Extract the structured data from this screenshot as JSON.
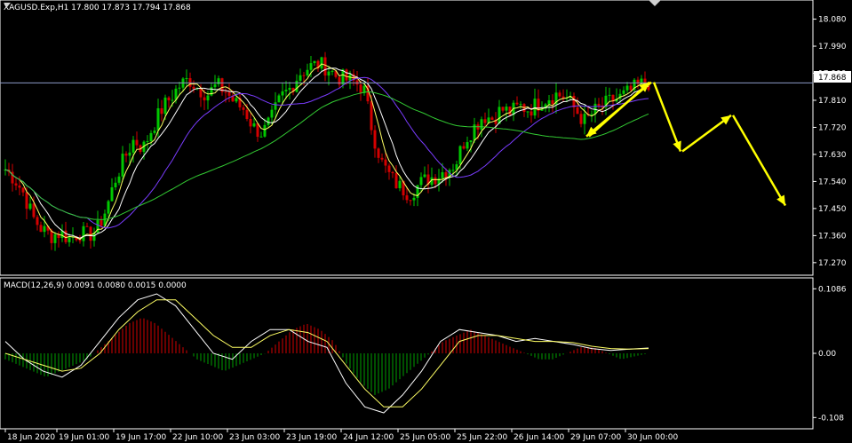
{
  "header": {
    "symbol_line": "XAGUSD.Exp,H1  17.800 17.873 17.794 17.868",
    "macd_line": "MACD(12,26,9) 0.0091 0.0080 0.0015 0.0000"
  },
  "colors": {
    "background": "#000000",
    "bull_candle": "#00c800",
    "bear_candle": "#d40000",
    "ma_fast": "#ffff64",
    "ma_mid": "#ffffff",
    "ma_slow_violet": "#7a3cff",
    "ma_slow_green": "#32c832",
    "macd_line": "#ffffff",
    "signal_line": "#ffff64",
    "hist_pos": "#d40000",
    "hist_neg": "#00a000",
    "arrows": "#ffff00",
    "axis_text": "#ffffff",
    "price_line": "#8c9ac8"
  },
  "chart_data": [
    {
      "type": "candlestick",
      "ylim": [
        17.24,
        18.12
      ],
      "y_ticks": [
        "18.080",
        "17.990",
        "17.900",
        "17.810",
        "17.720",
        "17.630",
        "17.540",
        "17.450",
        "17.360",
        "17.270"
      ],
      "x_ticks": [
        "18 Jun 2020",
        "19 Jun 01:00",
        "19 Jun 17:00",
        "22 Jun 10:00",
        "23 Jun 03:00",
        "23 Jun 19:00",
        "24 Jun 12:00",
        "25 Jun 05:00",
        "25 Jun 22:00",
        "26 Jun 14:00",
        "29 Jun 07:00",
        "30 Jun 00:00"
      ],
      "current_price": "17.868",
      "close_profile": [
        17.58,
        17.55,
        17.5,
        17.42,
        17.38,
        17.36,
        17.37,
        17.35,
        17.37,
        17.36,
        17.38,
        17.45,
        17.55,
        17.62,
        17.68,
        17.65,
        17.72,
        17.78,
        17.82,
        17.86,
        17.88,
        17.85,
        17.83,
        17.86,
        17.84,
        17.8,
        17.78,
        17.72,
        17.7,
        17.75,
        17.82,
        17.85,
        17.9,
        17.92,
        17.93,
        17.92,
        17.89,
        17.88,
        17.87,
        17.85,
        17.7,
        17.6,
        17.55,
        17.52,
        17.5,
        17.53,
        17.55,
        17.56,
        17.58,
        17.6,
        17.68,
        17.72,
        17.76,
        17.75,
        17.78,
        17.77,
        17.79,
        17.78,
        17.8,
        17.82,
        17.83,
        17.82,
        17.78,
        17.74,
        17.77,
        17.79,
        17.81,
        17.82,
        17.84,
        17.86,
        17.87
      ],
      "overlays": [
        "ma_fast",
        "ma_mid",
        "ma_slow_violet",
        "ma_slow_green"
      ],
      "annotation_arrows": [
        [
          17.87,
          17.69
        ],
        [
          17.69,
          17.87
        ],
        [
          17.87,
          17.64
        ],
        [
          17.64,
          17.76
        ],
        [
          17.76,
          17.46
        ]
      ]
    },
    {
      "type": "macd",
      "ylim": [
        -0.115,
        0.115
      ],
      "y_ticks": [
        "0.1086",
        "0.00",
        "-0.108"
      ],
      "histogram_profile": [
        -0.01,
        -0.02,
        -0.03,
        -0.04,
        -0.03,
        -0.02,
        -0.01,
        0.01,
        0.03,
        0.05,
        0.06,
        0.05,
        0.03,
        0.01,
        -0.01,
        -0.02,
        -0.03,
        -0.02,
        -0.01,
        0.0,
        0.02,
        0.04,
        0.05,
        0.04,
        0.02,
        -0.02,
        -0.05,
        -0.07,
        -0.06,
        -0.04,
        -0.02,
        0.0,
        0.02,
        0.03,
        0.04,
        0.03,
        0.02,
        0.01,
        0.0,
        -0.01,
        -0.01,
        0.0,
        0.01,
        0.01,
        0.0,
        -0.01,
        -0.005,
        0.0
      ],
      "macd_profile": [
        0.02,
        -0.01,
        -0.03,
        -0.04,
        -0.02,
        0.02,
        0.06,
        0.09,
        0.1,
        0.08,
        0.04,
        0.0,
        -0.01,
        0.02,
        0.04,
        0.04,
        0.02,
        0.01,
        -0.05,
        -0.09,
        -0.1,
        -0.07,
        -0.03,
        0.02,
        0.04,
        0.035,
        0.03,
        0.02,
        0.025,
        0.02,
        0.015,
        0.008,
        0.005,
        0.007,
        0.009
      ],
      "signal_profile": [
        0.0,
        -0.01,
        -0.02,
        -0.03,
        -0.025,
        0.0,
        0.04,
        0.07,
        0.09,
        0.09,
        0.06,
        0.03,
        0.01,
        0.01,
        0.03,
        0.04,
        0.035,
        0.02,
        -0.02,
        -0.06,
        -0.09,
        -0.09,
        -0.06,
        -0.02,
        0.02,
        0.03,
        0.03,
        0.025,
        0.02,
        0.02,
        0.018,
        0.012,
        0.008,
        0.007,
        0.008
      ]
    }
  ]
}
